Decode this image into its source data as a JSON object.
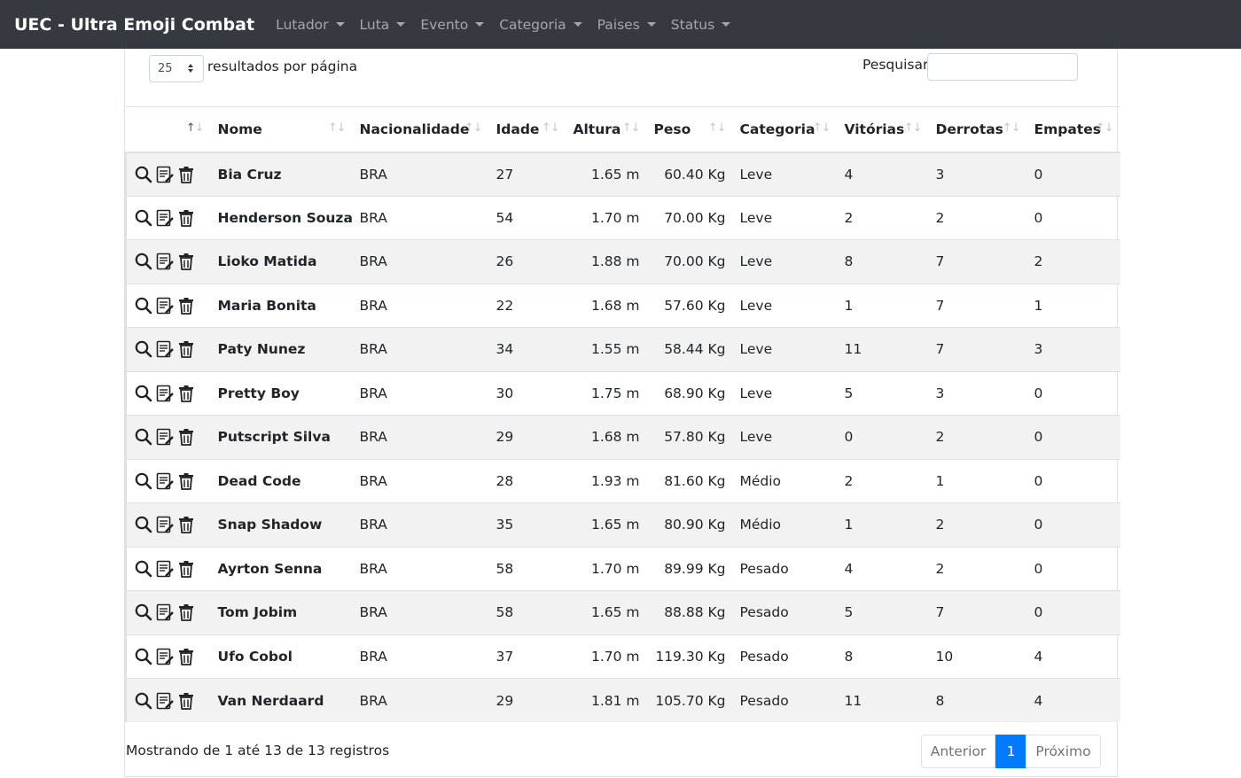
{
  "navbar": {
    "brand": "UEC - Ultra Emoji Combat",
    "menus": [
      {
        "label": "Lutador"
      },
      {
        "label": "Luta"
      },
      {
        "label": "Evento"
      },
      {
        "label": "Categoria"
      },
      {
        "label": "Paises"
      },
      {
        "label": "Status"
      }
    ]
  },
  "controls": {
    "page_length": "25",
    "page_length_label": "resultados por página",
    "search_label": "Pesquisar",
    "search_value": ""
  },
  "table": {
    "columns": [
      "",
      "Nome",
      "Nacionalidade",
      "Idade",
      "Altura",
      "Peso",
      "Categoria",
      "Vitórias",
      "Derrotas",
      "Empates"
    ],
    "action_icons": [
      "search-icon",
      "edit-icon",
      "trash-icon"
    ],
    "rows": [
      {
        "nome": "Bia Cruz",
        "nacionalidade": "BRA",
        "idade": "27",
        "altura": "1.65 m",
        "peso": "60.40 Kg",
        "categoria": "Leve",
        "vitorias": "4",
        "derrotas": "3",
        "empates": "0"
      },
      {
        "nome": "Henderson Souza",
        "nacionalidade": "BRA",
        "idade": "54",
        "altura": "1.70 m",
        "peso": "70.00 Kg",
        "categoria": "Leve",
        "vitorias": "2",
        "derrotas": "2",
        "empates": "0"
      },
      {
        "nome": "Lioko Matida",
        "nacionalidade": "BRA",
        "idade": "26",
        "altura": "1.88 m",
        "peso": "70.00 Kg",
        "categoria": "Leve",
        "vitorias": "8",
        "derrotas": "7",
        "empates": "2"
      },
      {
        "nome": "Maria Bonita",
        "nacionalidade": "BRA",
        "idade": "22",
        "altura": "1.68 m",
        "peso": "57.60 Kg",
        "categoria": "Leve",
        "vitorias": "1",
        "derrotas": "7",
        "empates": "1"
      },
      {
        "nome": "Paty Nunez",
        "nacionalidade": "BRA",
        "idade": "34",
        "altura": "1.55 m",
        "peso": "58.44 Kg",
        "categoria": "Leve",
        "vitorias": "11",
        "derrotas": "7",
        "empates": "3"
      },
      {
        "nome": "Pretty Boy",
        "nacionalidade": "BRA",
        "idade": "30",
        "altura": "1.75 m",
        "peso": "68.90 Kg",
        "categoria": "Leve",
        "vitorias": "5",
        "derrotas": "3",
        "empates": "0"
      },
      {
        "nome": "Putscript Silva",
        "nacionalidade": "BRA",
        "idade": "29",
        "altura": "1.68 m",
        "peso": "57.80 Kg",
        "categoria": "Leve",
        "vitorias": "0",
        "derrotas": "2",
        "empates": "0"
      },
      {
        "nome": "Dead Code",
        "nacionalidade": "BRA",
        "idade": "28",
        "altura": "1.93 m",
        "peso": "81.60 Kg",
        "categoria": "Médio",
        "vitorias": "2",
        "derrotas": "1",
        "empates": "0"
      },
      {
        "nome": "Snap Shadow",
        "nacionalidade": "BRA",
        "idade": "35",
        "altura": "1.65 m",
        "peso": "80.90 Kg",
        "categoria": "Médio",
        "vitorias": "1",
        "derrotas": "2",
        "empates": "0"
      },
      {
        "nome": "Ayrton Senna",
        "nacionalidade": "BRA",
        "idade": "58",
        "altura": "1.70 m",
        "peso": "89.99 Kg",
        "categoria": "Pesado",
        "vitorias": "4",
        "derrotas": "2",
        "empates": "0"
      },
      {
        "nome": "Tom Jobim",
        "nacionalidade": "BRA",
        "idade": "58",
        "altura": "1.65 m",
        "peso": "88.88 Kg",
        "categoria": "Pesado",
        "vitorias": "5",
        "derrotas": "7",
        "empates": "0"
      },
      {
        "nome": "Ufo Cobol",
        "nacionalidade": "BRA",
        "idade": "37",
        "altura": "1.70 m",
        "peso": "119.30 Kg",
        "categoria": "Pesado",
        "vitorias": "8",
        "derrotas": "10",
        "empates": "4"
      },
      {
        "nome": "Van Nerdaard",
        "nacionalidade": "BRA",
        "idade": "29",
        "altura": "1.81 m",
        "peso": "105.70 Kg",
        "categoria": "Pesado",
        "vitorias": "11",
        "derrotas": "8",
        "empates": "4"
      }
    ]
  },
  "footer": {
    "info": "Mostrando de 1 até 13 de 13 registros",
    "prev_label": "Anterior",
    "current_page": "1",
    "next_label": "Próximo"
  },
  "colors": {
    "navbar_bg": "#343a40",
    "accent": "#007bff",
    "striped_row": "#f2f2f2"
  }
}
